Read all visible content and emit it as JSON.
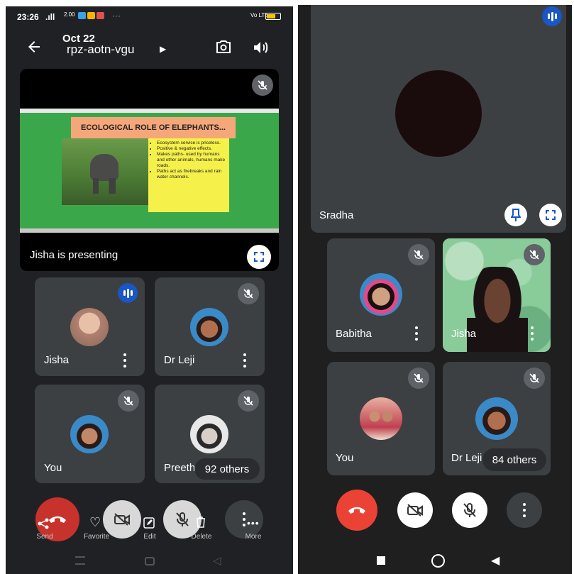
{
  "left_screen": {
    "status_bar": {
      "time": "23:26",
      "signal": ".ıll",
      "net_speed": "2.00",
      "dots": "···",
      "volte": "Vo LTE"
    },
    "header": {
      "date": "Oct 22",
      "meeting_code": "rpz-aotn-vgu"
    },
    "presentation": {
      "slide_title": "ECOLOGICAL ROLE OF ELEPHANTS...",
      "bullets": [
        "Ecosystem service is priceless.",
        "Positive & negative effects.",
        "Makes paths- used by humans and other animals, humans make roads.",
        "Paths act as firebreaks and rain water channels."
      ],
      "presenter_label": "Jisha is presenting"
    },
    "tiles": [
      {
        "name": "Jisha"
      },
      {
        "name": "Dr Leji"
      },
      {
        "name": "You"
      },
      {
        "name": "Preeth"
      }
    ],
    "others_count": "92 others",
    "bottom_actions": [
      "Send",
      "Favorite",
      "Edit",
      "Delete",
      "More"
    ]
  },
  "right_screen": {
    "top_tile_name": "Sradha",
    "tiles": [
      {
        "name": "Babitha"
      },
      {
        "name": "Jisha"
      },
      {
        "name": "You"
      },
      {
        "name": "Dr Leji"
      }
    ],
    "others_count": "84 others"
  },
  "colors": {
    "end_call": "#ea4335",
    "speaking_blue": "#1a56c4",
    "tile": "#3c4043",
    "background": "#202124"
  }
}
